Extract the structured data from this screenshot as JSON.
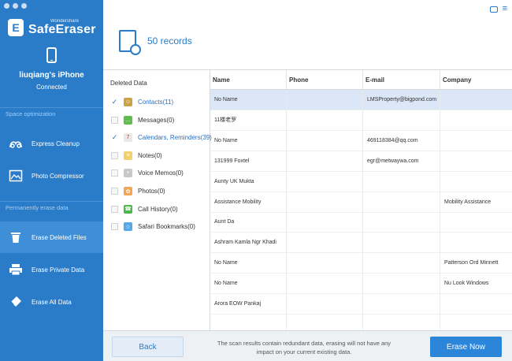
{
  "app": {
    "brand_small": "Wondershare",
    "brand_name": "SafeEraser",
    "logo_letter": "E"
  },
  "device": {
    "name": "liuqiang's iPhone",
    "status": "Connected"
  },
  "sidebar": {
    "section_optimization": "Space optimization",
    "section_erase": "Permanently erase data",
    "items": [
      {
        "label": "Express Cleanup",
        "icon": "express-cleanup-icon"
      },
      {
        "label": "Photo Compressor",
        "icon": "photo-compressor-icon"
      },
      {
        "label": "Erase Deleted Files",
        "icon": "trash-icon",
        "active": true
      },
      {
        "label": "Erase Private Data",
        "icon": "printer-icon"
      },
      {
        "label": "Erase All Data",
        "icon": "eraser-icon"
      }
    ]
  },
  "header": {
    "records": "50 records"
  },
  "categories": {
    "title": "Deleted Data",
    "items": [
      {
        "label": "Contacts(11)",
        "checked": true,
        "icon": "contacts-icon",
        "color": "#c9a24a"
      },
      {
        "label": "Messages(0)",
        "checked": false,
        "icon": "messages-icon",
        "color": "#5fbf4c"
      },
      {
        "label": "Calendars, Reminders(39)",
        "checked": true,
        "icon": "calendar-icon",
        "color": "#e9e9e9"
      },
      {
        "label": "Notes(0)",
        "checked": false,
        "icon": "notes-icon",
        "color": "#f0d070"
      },
      {
        "label": "Voice Memos(0)",
        "checked": false,
        "icon": "voice-memos-icon",
        "color": "#c9c9c9"
      },
      {
        "label": "Photos(0)",
        "checked": false,
        "icon": "photos-icon",
        "color": "#f2a65a"
      },
      {
        "label": "Call History(0)",
        "checked": false,
        "icon": "call-history-icon",
        "color": "#4cb84c"
      },
      {
        "label": "Safari Bookmarks(0)",
        "checked": false,
        "icon": "safari-icon",
        "color": "#55a9e8"
      }
    ]
  },
  "table": {
    "columns": [
      "Name",
      "Phone",
      "E-mail",
      "Company"
    ],
    "rows": [
      [
        "No Name",
        "",
        "LMSProperty@bigpond.com",
        ""
      ],
      [
        "11楼老罗",
        "",
        "",
        ""
      ],
      [
        "No Name",
        "",
        "469118384@qq.com",
        ""
      ],
      [
        "131999 Foxtel",
        "",
        "egr@metwaywa.com",
        ""
      ],
      [
        "Aunty UK Mukta",
        "",
        "",
        ""
      ],
      [
        "Assistance Mobility",
        "",
        "",
        "Mobility Assistance"
      ],
      [
        "Aunt Da",
        "",
        "",
        ""
      ],
      [
        "Ashram Kamla Ngr Khadi",
        "",
        "",
        ""
      ],
      [
        "No Name",
        "",
        "",
        "Patterson Ord Minnett"
      ],
      [
        "No Name",
        "",
        "",
        "Nu Look Windows"
      ],
      [
        "Arora EOW Pankaj",
        "",
        "",
        ""
      ],
      [
        "",
        "",
        "",
        ""
      ]
    ]
  },
  "footer": {
    "back_label": "Back",
    "notice": "The scan results contain redundant data, erasing will not have any impact on your current existing data.",
    "erase_label": "Erase Now"
  },
  "colors": {
    "sidebar": "#2a7cc8",
    "accent": "#2b86d9",
    "selected_row": "#dbe7f7"
  }
}
